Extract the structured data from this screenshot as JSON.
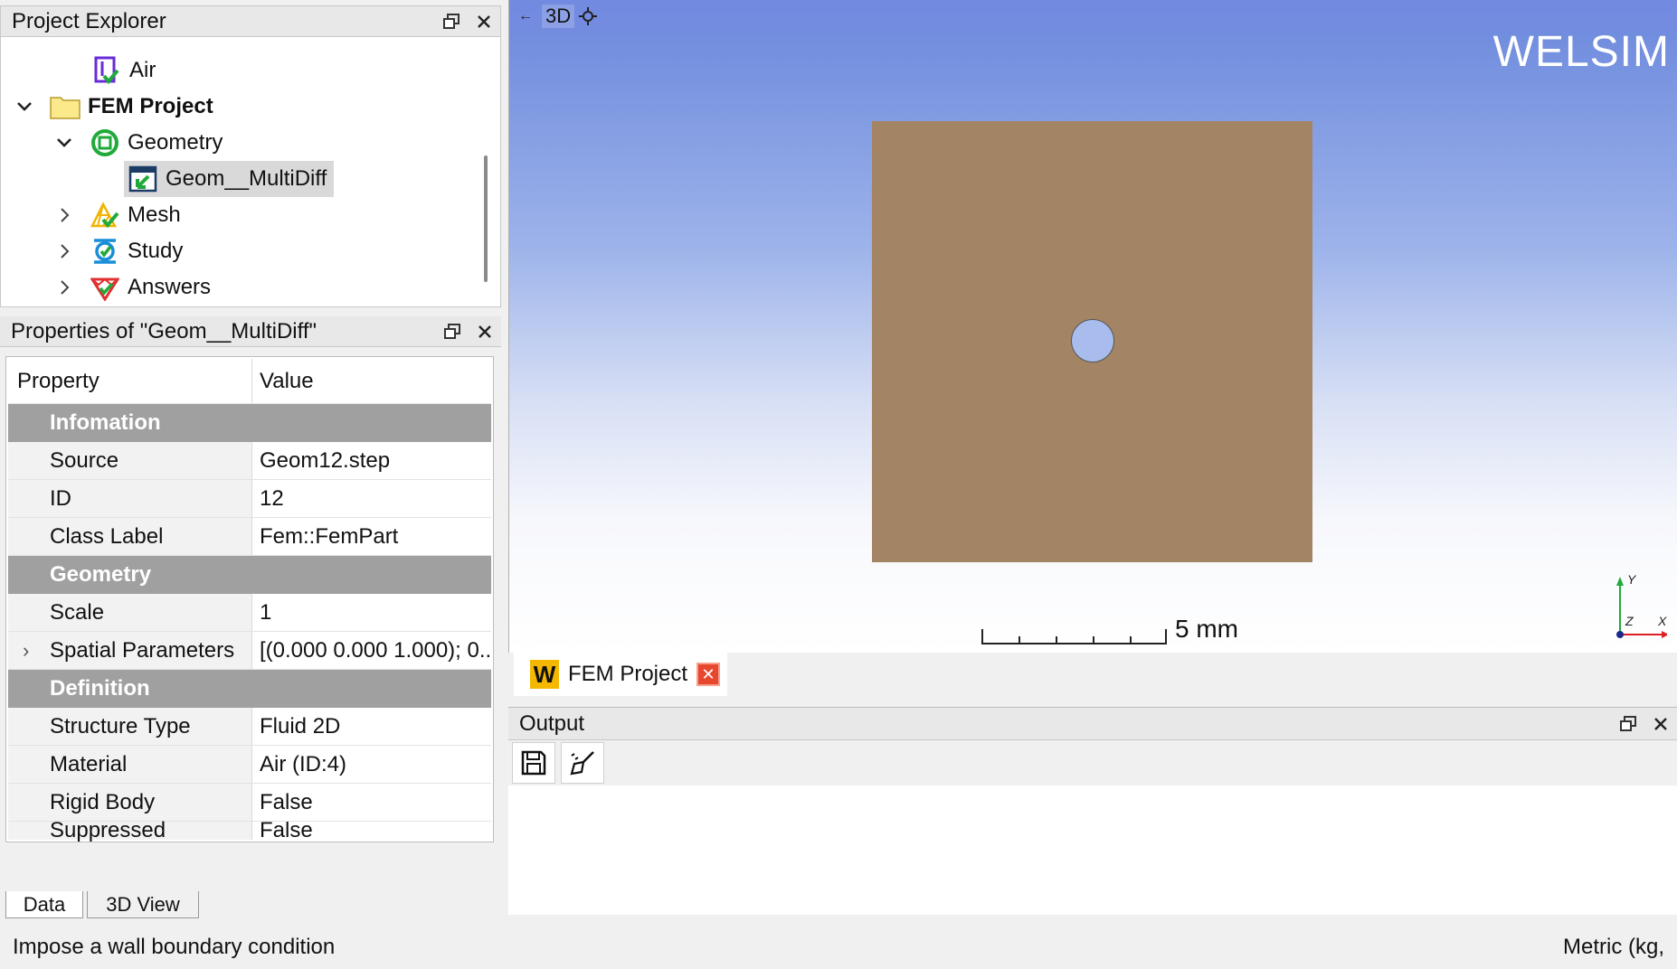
{
  "explorer": {
    "title": "Project Explorer",
    "items": [
      {
        "label": "Air",
        "icon": "material-icon"
      },
      {
        "label": "FEM Project",
        "icon": "folder-icon"
      },
      {
        "label": "Geometry",
        "icon": "geometry-icon"
      },
      {
        "label": "Geom__MultiDiff",
        "icon": "geom-part-icon"
      },
      {
        "label": "Mesh",
        "icon": "mesh-icon"
      },
      {
        "label": "Study",
        "icon": "study-icon"
      },
      {
        "label": "Answers",
        "icon": "answers-icon"
      }
    ]
  },
  "properties": {
    "title": "Properties of \"Geom__MultiDiff\"",
    "header": {
      "property": "Property",
      "value": "Value"
    },
    "groups": [
      {
        "name": "Infomation",
        "rows": [
          {
            "key": "Source",
            "value": "Geom12.step"
          },
          {
            "key": "ID",
            "value": "12"
          },
          {
            "key": "Class Label",
            "value": "Fem::FemPart"
          }
        ]
      },
      {
        "name": "Geometry",
        "rows": [
          {
            "key": "Scale",
            "value": "1"
          },
          {
            "key": "Spatial Parameters",
            "value": "[(0.000 0.000 1.000); 0..."
          }
        ]
      },
      {
        "name": "Definition",
        "rows": [
          {
            "key": "Structure Type",
            "value": "Fluid 2D"
          },
          {
            "key": "Material",
            "value": "Air (ID:4)"
          },
          {
            "key": "Rigid Body",
            "value": "False"
          },
          {
            "key": "Suppressed",
            "value": "False"
          }
        ]
      }
    ],
    "tabs": [
      "Data",
      "3D View"
    ]
  },
  "viewport": {
    "mode_label": "3D",
    "brand": "WELSIM",
    "scale_label": "5 mm",
    "axes": {
      "y": "Y",
      "z": "Z",
      "x": "X"
    },
    "colors": {
      "plate": "#a38464",
      "hole": "#a8bdee"
    }
  },
  "doc_tab": {
    "logo": "W",
    "label": "FEM Project"
  },
  "output": {
    "title": "Output"
  },
  "status": {
    "left": "Impose a wall boundary condition",
    "right": "Metric (kg,"
  }
}
